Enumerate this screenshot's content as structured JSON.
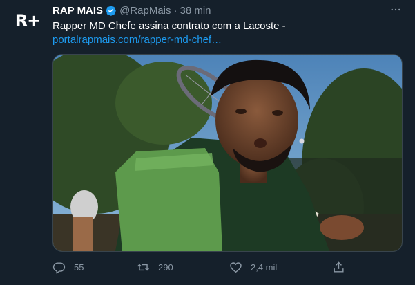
{
  "tweet": {
    "avatar_text": "R+",
    "name": "RAP MAIS",
    "handle": "@RapMais",
    "separator": "·",
    "time": "38 min",
    "text": "Rapper MD Chefe assina contrato com a Lacoste -",
    "link": "portalrapmais.com/rapper-md-chef…",
    "media_subject": "man in green polo with green towel holding a tennis racket"
  },
  "actions": {
    "replies": "55",
    "retweets": "290",
    "likes": "2,4 mil"
  },
  "colors": {
    "background": "#15202b",
    "text": "#ffffff",
    "secondary": "#8b98a5",
    "link": "#1d9bf0",
    "verified": "#1d9bf0"
  },
  "icons": [
    "verified-badge-icon",
    "more-icon",
    "reply-icon",
    "retweet-icon",
    "like-icon",
    "share-icon"
  ]
}
